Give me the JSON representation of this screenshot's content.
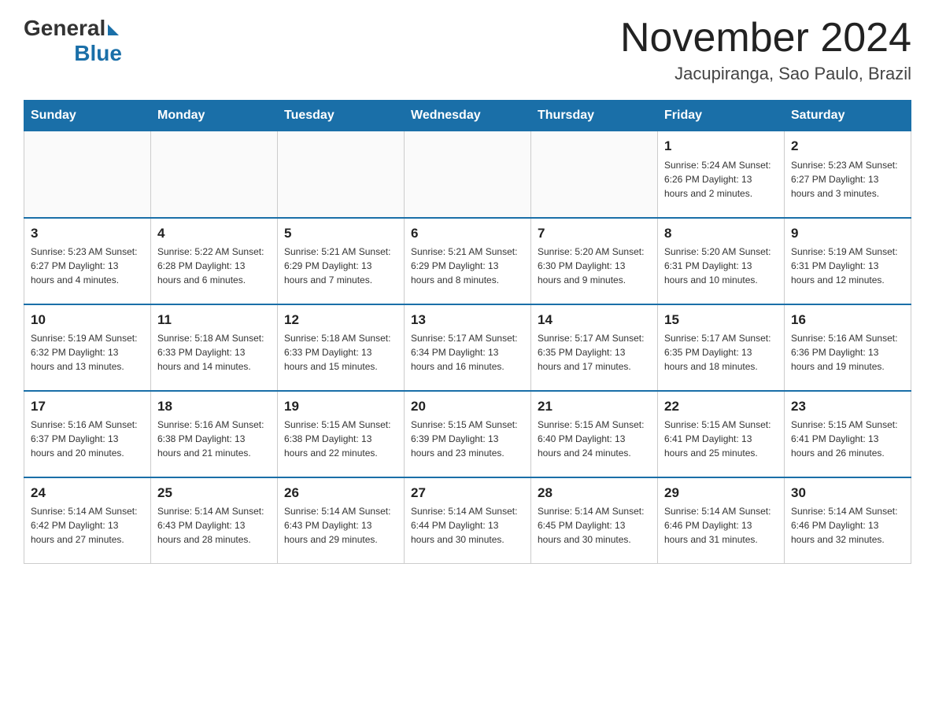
{
  "header": {
    "logo_general": "General",
    "logo_blue": "Blue",
    "title": "November 2024",
    "subtitle": "Jacupiranga, Sao Paulo, Brazil"
  },
  "days_of_week": [
    "Sunday",
    "Monday",
    "Tuesday",
    "Wednesday",
    "Thursday",
    "Friday",
    "Saturday"
  ],
  "weeks": [
    [
      {
        "day": "",
        "info": ""
      },
      {
        "day": "",
        "info": ""
      },
      {
        "day": "",
        "info": ""
      },
      {
        "day": "",
        "info": ""
      },
      {
        "day": "",
        "info": ""
      },
      {
        "day": "1",
        "info": "Sunrise: 5:24 AM\nSunset: 6:26 PM\nDaylight: 13 hours and 2 minutes."
      },
      {
        "day": "2",
        "info": "Sunrise: 5:23 AM\nSunset: 6:27 PM\nDaylight: 13 hours and 3 minutes."
      }
    ],
    [
      {
        "day": "3",
        "info": "Sunrise: 5:23 AM\nSunset: 6:27 PM\nDaylight: 13 hours and 4 minutes."
      },
      {
        "day": "4",
        "info": "Sunrise: 5:22 AM\nSunset: 6:28 PM\nDaylight: 13 hours and 6 minutes."
      },
      {
        "day": "5",
        "info": "Sunrise: 5:21 AM\nSunset: 6:29 PM\nDaylight: 13 hours and 7 minutes."
      },
      {
        "day": "6",
        "info": "Sunrise: 5:21 AM\nSunset: 6:29 PM\nDaylight: 13 hours and 8 minutes."
      },
      {
        "day": "7",
        "info": "Sunrise: 5:20 AM\nSunset: 6:30 PM\nDaylight: 13 hours and 9 minutes."
      },
      {
        "day": "8",
        "info": "Sunrise: 5:20 AM\nSunset: 6:31 PM\nDaylight: 13 hours and 10 minutes."
      },
      {
        "day": "9",
        "info": "Sunrise: 5:19 AM\nSunset: 6:31 PM\nDaylight: 13 hours and 12 minutes."
      }
    ],
    [
      {
        "day": "10",
        "info": "Sunrise: 5:19 AM\nSunset: 6:32 PM\nDaylight: 13 hours and 13 minutes."
      },
      {
        "day": "11",
        "info": "Sunrise: 5:18 AM\nSunset: 6:33 PM\nDaylight: 13 hours and 14 minutes."
      },
      {
        "day": "12",
        "info": "Sunrise: 5:18 AM\nSunset: 6:33 PM\nDaylight: 13 hours and 15 minutes."
      },
      {
        "day": "13",
        "info": "Sunrise: 5:17 AM\nSunset: 6:34 PM\nDaylight: 13 hours and 16 minutes."
      },
      {
        "day": "14",
        "info": "Sunrise: 5:17 AM\nSunset: 6:35 PM\nDaylight: 13 hours and 17 minutes."
      },
      {
        "day": "15",
        "info": "Sunrise: 5:17 AM\nSunset: 6:35 PM\nDaylight: 13 hours and 18 minutes."
      },
      {
        "day": "16",
        "info": "Sunrise: 5:16 AM\nSunset: 6:36 PM\nDaylight: 13 hours and 19 minutes."
      }
    ],
    [
      {
        "day": "17",
        "info": "Sunrise: 5:16 AM\nSunset: 6:37 PM\nDaylight: 13 hours and 20 minutes."
      },
      {
        "day": "18",
        "info": "Sunrise: 5:16 AM\nSunset: 6:38 PM\nDaylight: 13 hours and 21 minutes."
      },
      {
        "day": "19",
        "info": "Sunrise: 5:15 AM\nSunset: 6:38 PM\nDaylight: 13 hours and 22 minutes."
      },
      {
        "day": "20",
        "info": "Sunrise: 5:15 AM\nSunset: 6:39 PM\nDaylight: 13 hours and 23 minutes."
      },
      {
        "day": "21",
        "info": "Sunrise: 5:15 AM\nSunset: 6:40 PM\nDaylight: 13 hours and 24 minutes."
      },
      {
        "day": "22",
        "info": "Sunrise: 5:15 AM\nSunset: 6:41 PM\nDaylight: 13 hours and 25 minutes."
      },
      {
        "day": "23",
        "info": "Sunrise: 5:15 AM\nSunset: 6:41 PM\nDaylight: 13 hours and 26 minutes."
      }
    ],
    [
      {
        "day": "24",
        "info": "Sunrise: 5:14 AM\nSunset: 6:42 PM\nDaylight: 13 hours and 27 minutes."
      },
      {
        "day": "25",
        "info": "Sunrise: 5:14 AM\nSunset: 6:43 PM\nDaylight: 13 hours and 28 minutes."
      },
      {
        "day": "26",
        "info": "Sunrise: 5:14 AM\nSunset: 6:43 PM\nDaylight: 13 hours and 29 minutes."
      },
      {
        "day": "27",
        "info": "Sunrise: 5:14 AM\nSunset: 6:44 PM\nDaylight: 13 hours and 30 minutes."
      },
      {
        "day": "28",
        "info": "Sunrise: 5:14 AM\nSunset: 6:45 PM\nDaylight: 13 hours and 30 minutes."
      },
      {
        "day": "29",
        "info": "Sunrise: 5:14 AM\nSunset: 6:46 PM\nDaylight: 13 hours and 31 minutes."
      },
      {
        "day": "30",
        "info": "Sunrise: 5:14 AM\nSunset: 6:46 PM\nDaylight: 13 hours and 32 minutes."
      }
    ]
  ]
}
